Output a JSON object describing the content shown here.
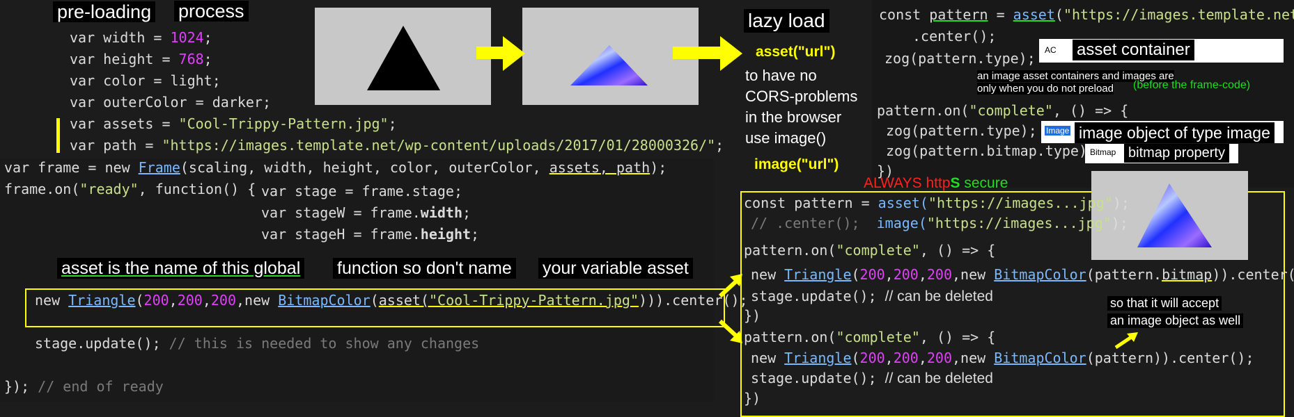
{
  "labels": {
    "preloading": "pre-loading",
    "process": "process",
    "lazy_load": "lazy load",
    "asset_global": "asset is the name of this global",
    "function_so": "function so don't name",
    "your_var": "your variable asset",
    "asset_container": "asset container",
    "image_object": "image object of type image",
    "bitmap_property": "bitmap property",
    "ac_tag": "AC",
    "image_tag": "Image",
    "bitmap_tag": "Bitmap"
  },
  "lazy_notes": {
    "asset_url": "asset(\"url\")",
    "to_have": "to have no",
    "cors": "CORS-problems",
    "browser": "in the browser",
    "use_image": "use image()",
    "image_url": "image(\"url\")"
  },
  "notes": {
    "container_note_1": "an image asset containers and images are",
    "container_note_2": "only when you do not preload",
    "before_frame": "(before the frame-code)",
    "always_https": "ALWAYS http",
    "https_s": "S",
    "secure": " secure",
    "accept_1": "so that it will accept",
    "accept_2": "an image object as well"
  },
  "code_left": {
    "width": [
      "var width = ",
      "1024",
      ";"
    ],
    "height": [
      "var height = ",
      "768",
      ";"
    ],
    "color": "var color = light;",
    "outer": "var outerColor = darker;",
    "assets": [
      "var assets = ",
      "\"Cool-Trippy-Pattern.jpg\"",
      ";"
    ],
    "path": [
      "var path = ",
      "\"https://images.template.net/wp-content/uploads/2017/01/28000326/\"",
      ";"
    ],
    "frame": [
      "var frame = new ",
      "Frame",
      "(scaling, width, height, color, outerColor, ",
      "assets, path",
      ");"
    ],
    "ready": [
      "frame.on(",
      "\"ready\"",
      ", function() {"
    ],
    "stage": "var stage = frame.stage;",
    "stageW": [
      "var stageW = frame.",
      "width",
      ";"
    ],
    "stageH": [
      "var stageH = frame.",
      "height",
      ";"
    ],
    "triangle": [
      "new ",
      "Triangle",
      "(",
      "200",
      ",",
      "200",
      ",",
      "200",
      ",new ",
      "BitmapColor",
      "(",
      "asset(",
      "\"Cool-Trippy-Pattern.jpg\"",
      ")",
      ")).center();"
    ],
    "update": [
      "stage.update(); ",
      "// this is needed to show any changes"
    ],
    "end": [
      "}); ",
      "// end of ready"
    ]
  },
  "code_right_top": {
    "line1": [
      "const ",
      "pattern",
      " = ",
      "asset",
      "(",
      "\"https://images.template.net/"
    ],
    "line2": ".center();",
    "line3": "zog(pattern.type);",
    "line4": [
      "pattern.on(",
      "\"complete\"",
      ", () => {"
    ],
    "line5": "zog(pattern.type);",
    "line6": "zog(pattern.bitmap.type);",
    "line7": "})"
  },
  "code_right_bottom": {
    "line1": [
      "const pattern = ",
      "asset(",
      "\"https://images...jpg\"",
      ");"
    ],
    "line2": [
      "// .center();  ",
      "image(",
      "\"https://images...jpg\"",
      ");"
    ],
    "line3": [
      "pattern.on(",
      "\"complete\"",
      ", () => {"
    ],
    "line4": [
      "new ",
      "Triangle",
      "(",
      "200",
      ",",
      "200",
      ",",
      "200",
      ",new ",
      "BitmapColor",
      "(pattern.",
      "bitmap",
      ")).center();"
    ],
    "line5": [
      "stage.update(); ",
      "// can be deleted"
    ],
    "line6": "})",
    "line7": [
      "pattern.on(",
      "\"complete\"",
      ", () => {"
    ],
    "line8": [
      "new ",
      "Triangle",
      "(",
      "200",
      ",",
      "200",
      ",",
      "200",
      ",new ",
      "BitmapColor",
      "(pattern)).center();"
    ],
    "line9": [
      "stage.update(); ",
      "// can be deleted"
    ],
    "line10": "})"
  },
  "colors": {
    "highlight": "#ffff00",
    "green": "#22dd22",
    "red": "#ff2020",
    "number": "#e040fb",
    "string": "#c9e08a",
    "link": "#7ab8ff"
  }
}
